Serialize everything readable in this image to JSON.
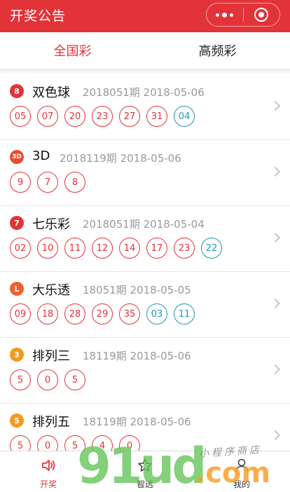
{
  "header": {
    "title": "开奖公告"
  },
  "tabs": [
    {
      "label": "全国彩",
      "active": true
    },
    {
      "label": "高频彩",
      "active": false
    }
  ],
  "colors": {
    "accent": "#e23339",
    "blue_ball": "#1e97b1"
  },
  "lotteries": [
    {
      "badge": "8",
      "badge_color": "#e23339",
      "name": "双色球",
      "period": "2018051期 2018-05-06",
      "red": [
        "05",
        "07",
        "20",
        "23",
        "27",
        "31"
      ],
      "blue": [
        "04"
      ]
    },
    {
      "badge": "3D",
      "badge_color": "#e94c2c",
      "name": "3D",
      "period": "2018119期 2018-05-06",
      "red": [
        "9",
        "7",
        "8"
      ],
      "blue": []
    },
    {
      "badge": "7",
      "badge_color": "#e23339",
      "name": "七乐彩",
      "period": "2018051期 2018-05-04",
      "red": [
        "02",
        "10",
        "11",
        "12",
        "14",
        "17",
        "23"
      ],
      "blue": [
        "22"
      ]
    },
    {
      "badge": "L",
      "badge_color": "#f0602a",
      "name": "大乐透",
      "period": "18051期 2018-05-05",
      "red": [
        "09",
        "18",
        "28",
        "29",
        "35"
      ],
      "blue": [
        "03",
        "11"
      ]
    },
    {
      "badge": "3",
      "badge_color": "#f39a1d",
      "name": "排列三",
      "period": "18119期 2018-05-06",
      "red": [
        "5",
        "0",
        "5"
      ],
      "blue": []
    },
    {
      "badge": "5",
      "badge_color": "#f39a1d",
      "name": "排列五",
      "period": "18119期 2018-05-06",
      "red": [
        "5",
        "0",
        "5",
        "4",
        "0"
      ],
      "blue": []
    }
  ],
  "bottom_nav": [
    {
      "label": "开奖",
      "icon": "speaker-icon",
      "active": true
    },
    {
      "label": "智选",
      "icon": "star-icon",
      "active": false
    },
    {
      "label": "我的",
      "icon": "user-icon",
      "active": false
    }
  ],
  "watermark": {
    "main": "91ud",
    "suffix": ".com",
    "tagline": "小程序商店"
  }
}
